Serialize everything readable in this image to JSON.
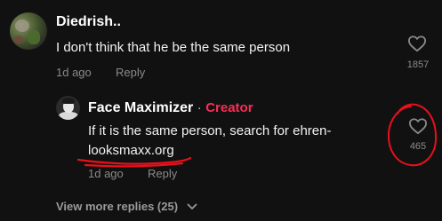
{
  "comment1": {
    "username": "Diedrish..",
    "text": "I don't think that he be the same person",
    "age": "1d ago",
    "reply_label": "Reply",
    "likes": "1857",
    "like_icon": "heart-outline"
  },
  "comment2": {
    "username": "Face Maximizer",
    "separator": "·",
    "badge": "Creator",
    "text_line1": "If it is the same person, search for ehren-",
    "text_line2": "looksmaxx.org",
    "age": "1d ago",
    "reply_label": "Reply",
    "likes": "465",
    "like_icon": "heart-outline"
  },
  "view_more": {
    "label": "View more replies (25)",
    "icon": "chevron-down"
  },
  "colors": {
    "background": "#111111",
    "creator_badge": "#fe2c55",
    "annotation": "#e8101c"
  }
}
